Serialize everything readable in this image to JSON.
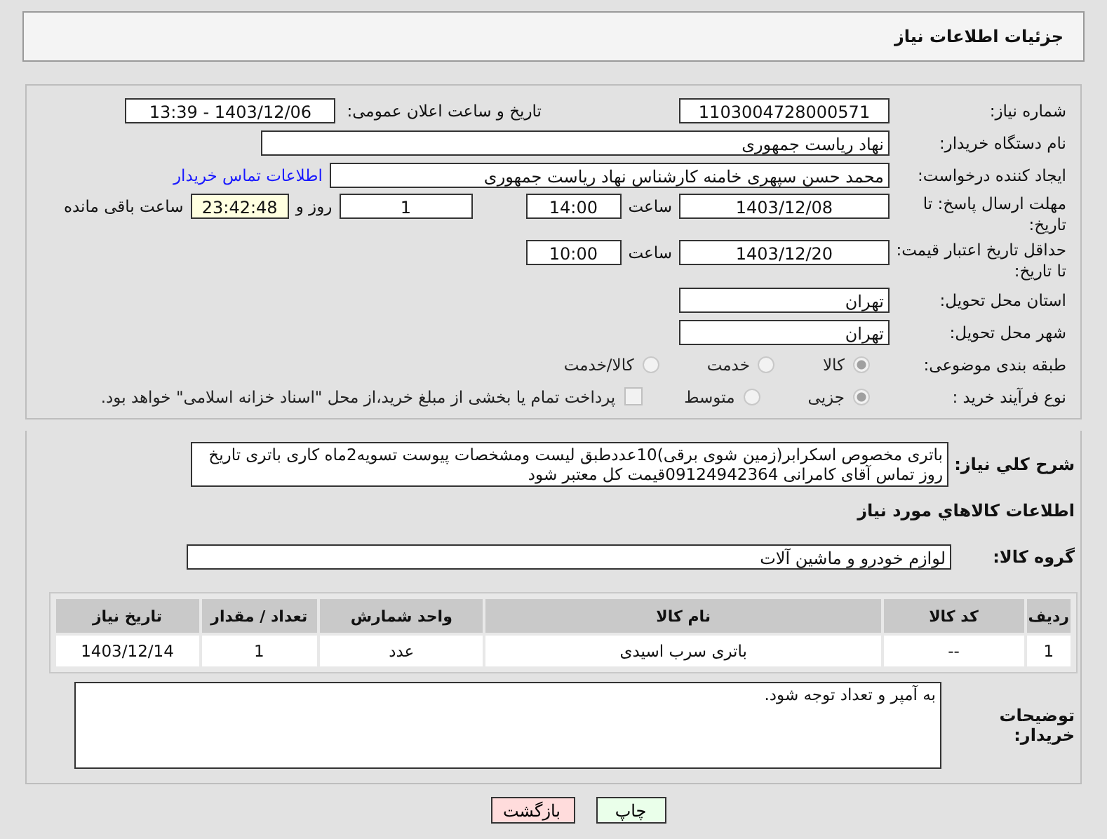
{
  "header": {
    "title": "جزئیات اطلاعات نیاز"
  },
  "form": {
    "need_number": {
      "label": "شماره نیاز:",
      "value": "1103004728000571"
    },
    "announce": {
      "label": "تاریخ و ساعت اعلان عمومی:",
      "value": "1403/12/06 - 13:39"
    },
    "buyer_org": {
      "label": "نام دستگاه خریدار:",
      "value": "نهاد ریاست جمهوری"
    },
    "requester": {
      "label": "ایجاد کننده درخواست:",
      "value": "محمد حسن سپهری خامنه کارشناس نهاد ریاست جمهوری",
      "link": "اطلاعات تماس خریدار"
    },
    "deadline": {
      "label": "مهلت ارسال پاسخ: تا تاریخ:",
      "date": "1403/12/08",
      "time_label": "ساعت",
      "time": "14:00",
      "days": "1",
      "days_label": "روز و",
      "remaining": "23:42:48",
      "remaining_label": "ساعت باقی مانده"
    },
    "price_validity": {
      "label": "حداقل تاریخ اعتبار قیمت: تا تاریخ:",
      "date": "1403/12/20",
      "time_label": "ساعت",
      "time": "10:00"
    },
    "province": {
      "label": "استان محل تحویل:",
      "value": "تهران"
    },
    "city": {
      "label": "شهر محل تحویل:",
      "value": "تهران"
    },
    "category": {
      "label": "طبقه بندی موضوعی:",
      "options": [
        {
          "label": "کالا",
          "selected": true
        },
        {
          "label": "خدمت",
          "selected": false
        },
        {
          "label": "کالا/خدمت",
          "selected": false
        }
      ]
    },
    "purchase_process": {
      "label": "نوع فرآیند خرید :",
      "options": [
        {
          "label": "جزیی",
          "selected": true
        },
        {
          "label": "متوسط",
          "selected": false
        }
      ],
      "checkbox": {
        "label": "پرداخت تمام یا بخشی از مبلغ خرید،از محل \"اسناد خزانه اسلامی\" خواهد بود.",
        "checked": false
      }
    }
  },
  "description": {
    "label": "شرح کلي نياز:",
    "value": "باتری مخصوص اسکرابر(زمین شوی برقی)10عددطبق لیست ومشخصات پیوست تسویه2ماه کاری باتری تاریخ روز تماس آقای کامرانی 09124942364قیمت کل معتبر شود"
  },
  "goods_heading": "اطلاعات کالاهاي مورد نياز",
  "goods_group": {
    "label": "گروه کالا:",
    "value": "لوازم خودرو و ماشین آلات"
  },
  "table": {
    "columns": [
      "ردیف",
      "کد کالا",
      "نام کالا",
      "واحد شمارش",
      "تعداد / مقدار",
      "تاریخ نیاز"
    ],
    "rows": [
      [
        "1",
        "--",
        "باتری سرب اسیدی",
        "عدد",
        "1",
        "1403/12/14"
      ]
    ]
  },
  "buyer_notes": {
    "label": "توضیحات خریدار:",
    "value": "به آمپر و تعداد توجه شود."
  },
  "buttons": [
    {
      "label": "چاپ",
      "kind": "print"
    },
    {
      "label": "بازگشت",
      "kind": "back"
    }
  ]
}
